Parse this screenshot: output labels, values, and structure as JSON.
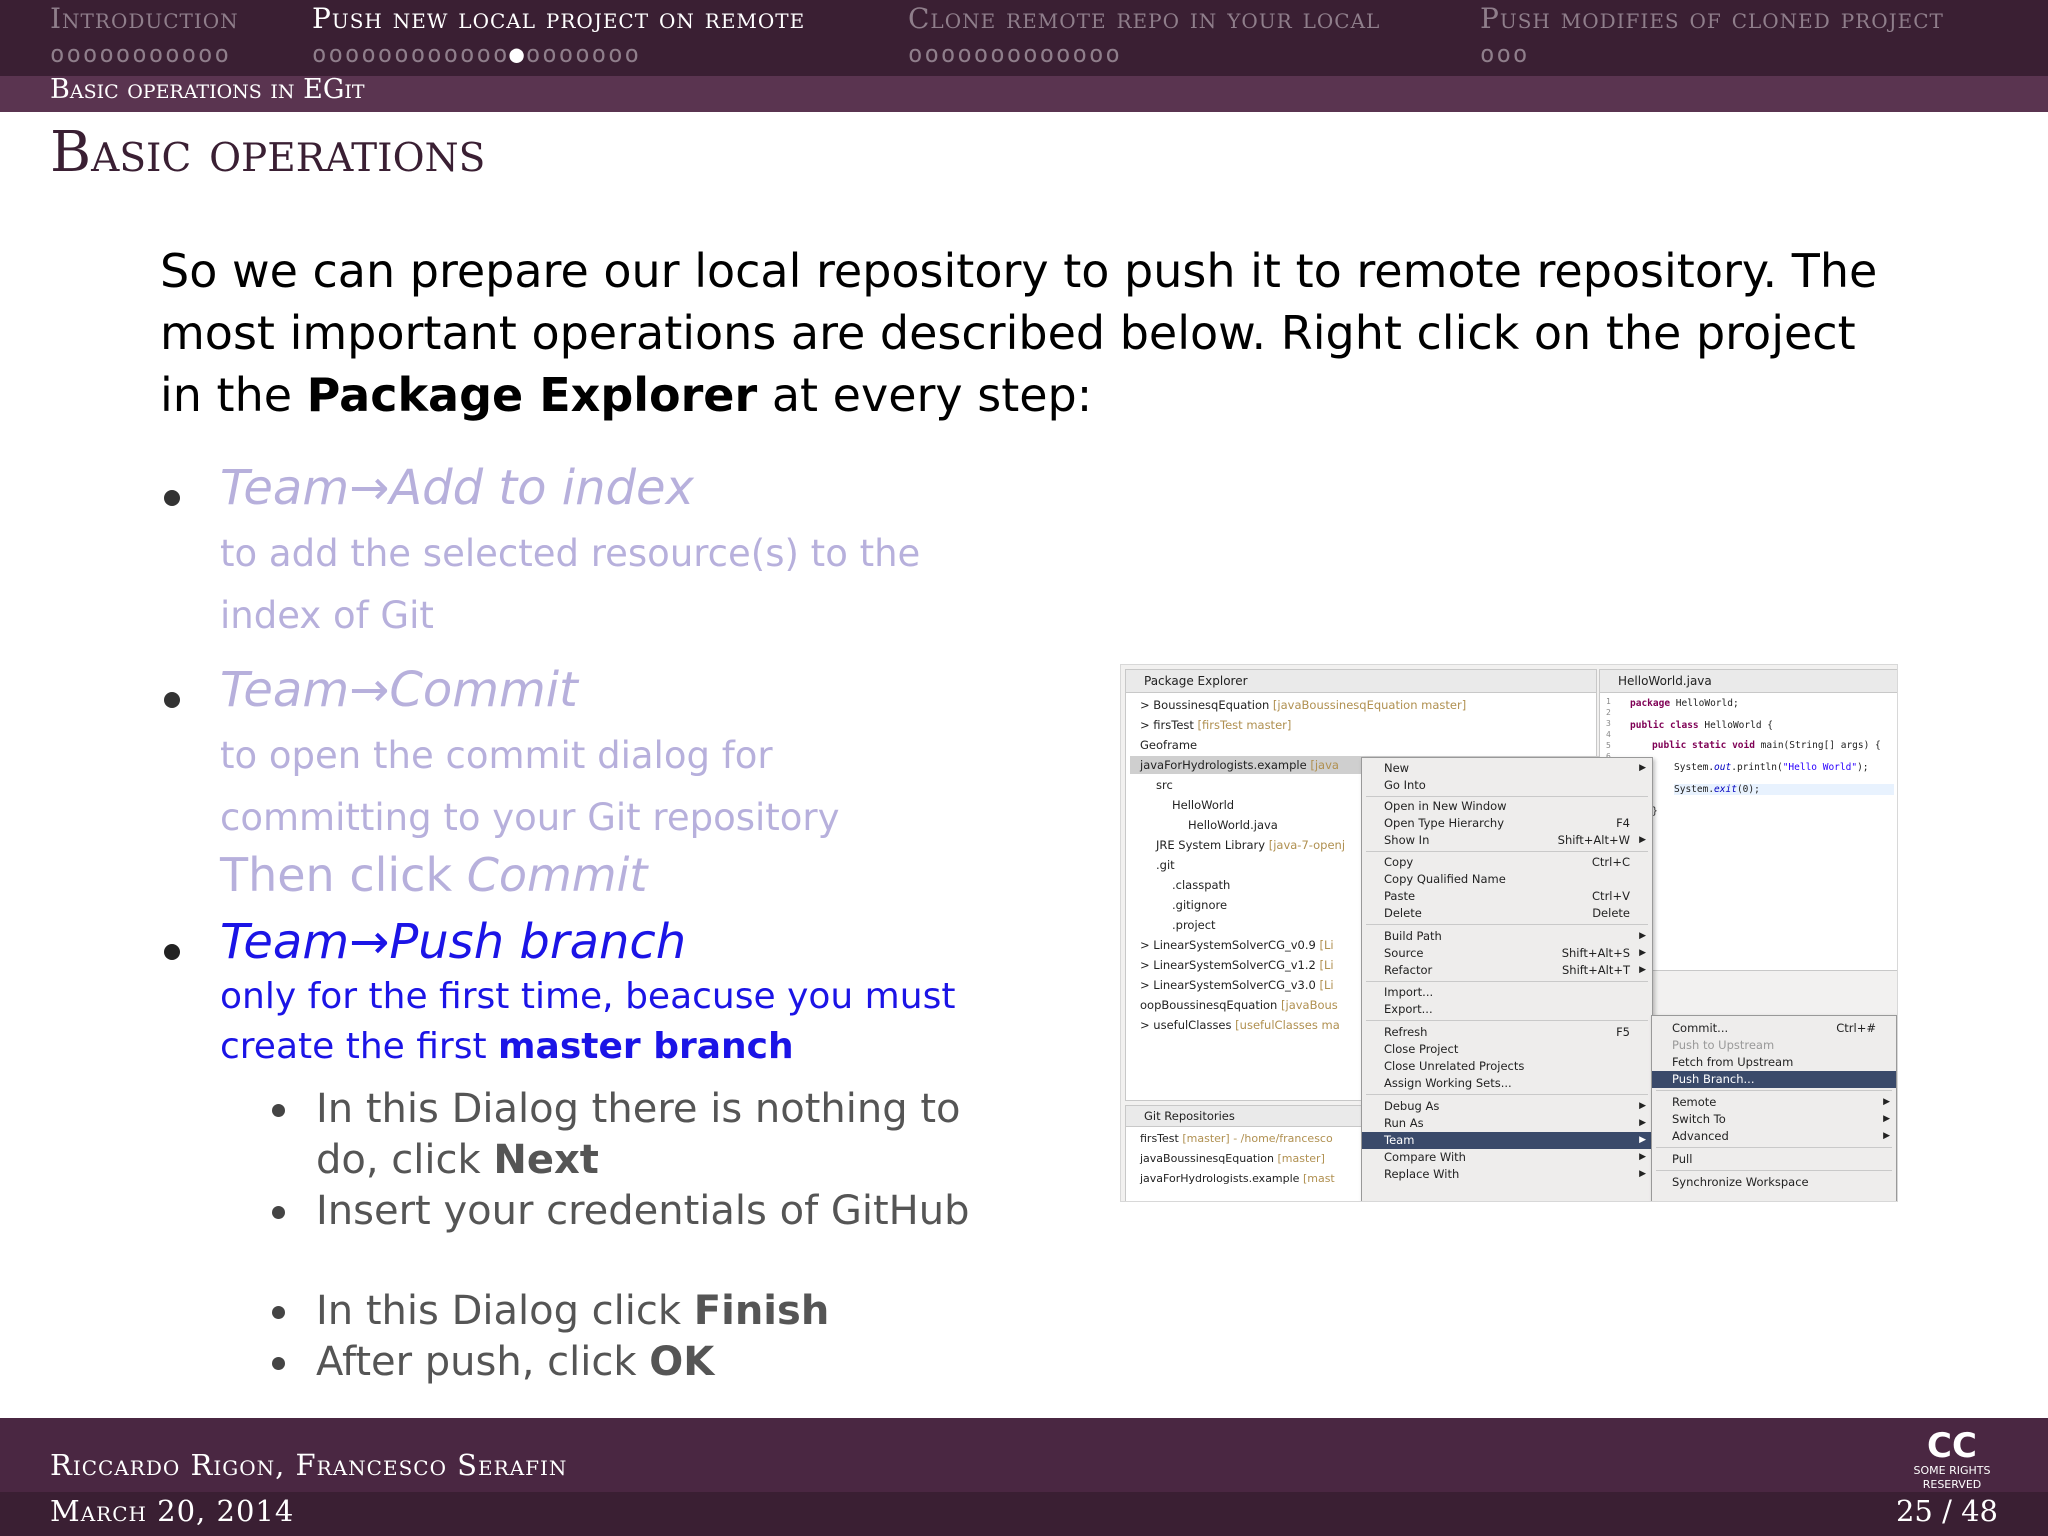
{
  "nav": {
    "sections": [
      {
        "label": "Introduction",
        "dots": "ooooooooooo"
      },
      {
        "label": "Push new local project on remote",
        "dots_before": "oooooooooooo",
        "current": "●",
        "dots_after": "ooooooo"
      },
      {
        "label": "Clone remote repo in your local",
        "dots": "ooooooooooooo"
      },
      {
        "label": "Push modifies of cloned project",
        "dots": "ooo"
      }
    ],
    "subsection": "Basic operations in EGit"
  },
  "frame": {
    "title": "Basic operations",
    "intro_1": "So we can prepare our local repository to push it to remote repository.  The most important operations are described below.  Right click on the project in the ",
    "intro_bold": "Package Explorer",
    "intro_2": " at every step:"
  },
  "bullets": [
    {
      "head": "Team→Add to index",
      "desc_1": "to add the selected resource(s) to the",
      "desc_2": "index of Git"
    },
    {
      "head": "Team→Commit",
      "desc_1": "to open the commit dialog for",
      "desc_2": "committing to your Git repository",
      "extra_1": "Then click ",
      "extra_italic": "Commit"
    },
    {
      "head": "Team→Push branch",
      "desc_1": "only for the first time, beacuse you must",
      "desc_2_a": "create the first ",
      "desc_2_bold": "master branch"
    }
  ],
  "subbullets": [
    {
      "a": "In this Dialog there is nothing to",
      "b": "do, click ",
      "bold": "Next"
    },
    {
      "a": "Insert your credentials of GitHub"
    },
    {
      "a": "In this Dialog click ",
      "bold": "Finish"
    },
    {
      "a": "After push, click ",
      "bold": "OK"
    }
  ],
  "screenshot": {
    "package_explorer_tab": "Package Explorer",
    "tree": [
      {
        "name": "> BoussinesqEquation",
        "meta": " [javaBoussinesqEquation master]"
      },
      {
        "name": "> firsTest",
        "meta": " [firsTest master]"
      },
      {
        "name": "Geoframe",
        "meta": ""
      },
      {
        "name": "javaForHydrologists.example",
        "meta": " [java"
      },
      {
        "name": "src",
        "meta": ""
      },
      {
        "name": "HelloWorld",
        "meta": ""
      },
      {
        "name": "HelloWorld.java",
        "meta": ""
      },
      {
        "name": "JRE System Library",
        "meta": " [java-7-openj"
      },
      {
        "name": ".git",
        "meta": ""
      },
      {
        "name": ".classpath",
        "meta": ""
      },
      {
        "name": ".gitignore",
        "meta": ""
      },
      {
        "name": ".project",
        "meta": ""
      },
      {
        "name": "> LinearSystemSolverCG_v0.9",
        "meta": " [Li"
      },
      {
        "name": "> LinearSystemSolverCG_v1.2",
        "meta": " [Li"
      },
      {
        "name": "> LinearSystemSolverCG_v3.0",
        "meta": " [Li"
      },
      {
        "name": "oopBoussinesqEquation",
        "meta": " [javaBous"
      },
      {
        "name": "> usefulClasses",
        "meta": " [usefulClasses ma"
      }
    ],
    "git_repos_tab": "Git Repositories",
    "git_repos": [
      {
        "name": "firsTest",
        "meta": " [master] - /home/francesco"
      },
      {
        "name": "javaBoussinesqEquation",
        "meta": " [master]"
      },
      {
        "name": "javaForHydrologists.example",
        "meta": " [mast"
      }
    ],
    "editor_tab": "HelloWorld.java",
    "code": {
      "l1_kw": "package",
      "l1": " HelloWorld;",
      "l3_kw": "public class",
      "l3": " HelloWorld {",
      "l5_kw": "public static void",
      "l5": " main(String[] args) {",
      "l6_a": "System.",
      "l6_st": "out",
      "l6_b": ".println(",
      "l6_str": "\"Hello World\"",
      "l6_c": ");",
      "l7_a": "System.",
      "l7_st": "exit",
      "l7_b": "(0);",
      "l9": "}",
      "line_numbers": "1\n2\n3\n4\n5\n6"
    },
    "context_menu": [
      {
        "label": "New",
        "acc": "",
        "sub": true
      },
      {
        "label": "Go Into",
        "acc": ""
      },
      {
        "label": "Open in New Window",
        "acc": ""
      },
      {
        "label": "Open Type Hierarchy",
        "acc": "F4"
      },
      {
        "label": "Show In",
        "acc": "Shift+Alt+W",
        "sub": true
      },
      {
        "label": "Copy",
        "acc": "Ctrl+C"
      },
      {
        "label": "Copy Qualified Name",
        "acc": ""
      },
      {
        "label": "Paste",
        "acc": "Ctrl+V"
      },
      {
        "label": "Delete",
        "acc": "Delete"
      },
      {
        "label": "Build Path",
        "acc": "",
        "sub": true
      },
      {
        "label": "Source",
        "acc": "Shift+Alt+S",
        "sub": true
      },
      {
        "label": "Refactor",
        "acc": "Shift+Alt+T",
        "sub": true
      },
      {
        "label": "Import...",
        "acc": ""
      },
      {
        "label": "Export...",
        "acc": ""
      },
      {
        "label": "Refresh",
        "acc": "F5"
      },
      {
        "label": "Close Project",
        "acc": ""
      },
      {
        "label": "Close Unrelated Projects",
        "acc": ""
      },
      {
        "label": "Assign Working Sets...",
        "acc": ""
      },
      {
        "label": "Debug As",
        "acc": "",
        "sub": true
      },
      {
        "label": "Run As",
        "acc": "",
        "sub": true
      },
      {
        "label": "Team",
        "acc": "",
        "sub": true
      },
      {
        "label": "Compare With",
        "acc": "",
        "sub": true
      },
      {
        "label": "Replace With",
        "acc": "",
        "sub": true
      }
    ],
    "team_menu": [
      {
        "label": "Commit...",
        "acc": "Ctrl+#"
      },
      {
        "label": "Push to Upstream",
        "acc": ""
      },
      {
        "label": "Fetch from Upstream",
        "acc": ""
      },
      {
        "label": "Push Branch...",
        "acc": ""
      },
      {
        "label": "Remote",
        "acc": "",
        "sub": true
      },
      {
        "label": "Switch To",
        "acc": "",
        "sub": true
      },
      {
        "label": "Advanced",
        "acc": "",
        "sub": true
      },
      {
        "label": "Pull",
        "acc": ""
      },
      {
        "label": "Synchronize Workspace",
        "acc": ""
      }
    ]
  },
  "footer": {
    "authors": "Riccardo Rigon, Francesco Serafin",
    "date": "March 20, 2014",
    "page": "25 / 48",
    "cc_big": "CC",
    "cc_small": "SOME RIGHTS RESERVED"
  },
  "colors": {
    "theme_dark": "#3a1f33",
    "theme_mid": "#5a3450",
    "active_blue": "#1b14e6",
    "faded_text": "#b7b0dc"
  }
}
